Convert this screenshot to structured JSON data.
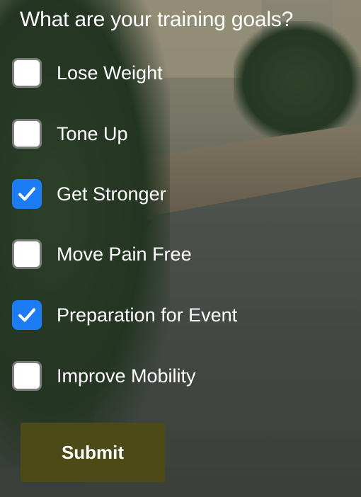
{
  "form": {
    "title": "What are your training goals?",
    "options": [
      {
        "label": "Lose Weight",
        "checked": false
      },
      {
        "label": "Tone Up",
        "checked": false
      },
      {
        "label": "Get Stronger",
        "checked": true
      },
      {
        "label": "Move Pain Free",
        "checked": false
      },
      {
        "label": "Preparation for Event",
        "checked": true
      },
      {
        "label": "Improve Mobility",
        "checked": false
      }
    ],
    "submit_label": "Submit"
  },
  "colors": {
    "checkbox_checked": "#1b7cf3",
    "submit_button": "#4c4a16"
  },
  "icons": {
    "checked_mark": "checkmark-icon",
    "background": "riverside-background-image"
  }
}
